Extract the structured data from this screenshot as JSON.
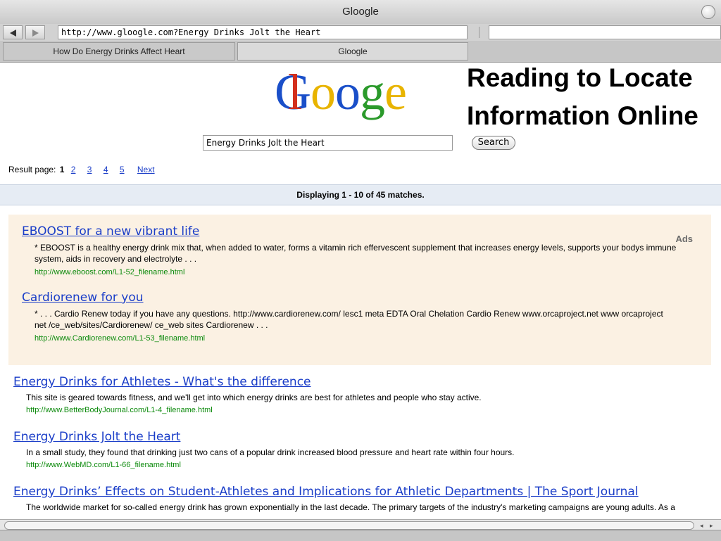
{
  "window": {
    "title": "Gloogle"
  },
  "toolbar": {
    "address": "http://www.gloogle.com?Energy Drinks Jolt the Heart"
  },
  "tabs": [
    {
      "label": "How Do Energy Drinks Affect Heart"
    },
    {
      "label": "Gloogle"
    }
  ],
  "overlay": {
    "line1": "Reading to Locate",
    "line2": "Information Online"
  },
  "logo": {
    "letters": [
      "G",
      "l",
      "o",
      "o",
      "g",
      "l",
      "e"
    ]
  },
  "search": {
    "query": "Energy Drinks Jolt the Heart",
    "button": "Search"
  },
  "pager": {
    "label": "Result page:",
    "current": "1",
    "pages": [
      "2",
      "3",
      "4",
      "5"
    ],
    "next": "Next"
  },
  "summary": "Displaying 1 - 10 of 45 matches.",
  "ads": {
    "label": "Ads",
    "items": [
      {
        "title": "EBOOST for a new vibrant life",
        "snippet": "* EBOOST is a healthy energy drink mix that, when added to water, forms a vitamin rich effervescent supplement that increases energy levels, supports your bodys immune system, aids in recovery and electrolyte . . .",
        "url": "http://www.eboost.com/L1-52_filename.html"
      },
      {
        "title": "Cardiorenew for you",
        "snippet": "* . . . Cardio Renew today if you have any questions. http://www.cardiorenew.com/ lesc1 meta EDTA Oral Chelation Cardio Renew www.orcaproject.net www orcaproject net /ce_web/sites/Cardiorenew/ ce_web sites Cardiorenew . . .",
        "url": "http://www.Cardiorenew.com/L1-53_filename.html"
      }
    ]
  },
  "results": [
    {
      "title": "Energy Drinks for Athletes - What's the difference",
      "snippet": "This site is geared towards fitness, and we'll get into which energy drinks are best for athletes and people who stay active.",
      "url": "http://www.BetterBodyJournal.com/L1-4_filename.html"
    },
    {
      "title": "Energy Drinks Jolt the Heart",
      "snippet": "In a small study, they found that drinking just two cans of a popular drink increased blood pressure and heart rate within four hours.",
      "url": "http://www.WebMD.com/L1-66_filename.html"
    },
    {
      "title": "Energy Drinks’ Effects on Student-Athletes and Implications for Athletic Departments | The Sport Journal",
      "snippet": "The worldwide market for so-called energy drink has grown exponentially in the last decade. The primary targets of the industry's marketing campaigns are young adults. As a result, university and college athletes are frequent consumers of the products."
    }
  ]
}
